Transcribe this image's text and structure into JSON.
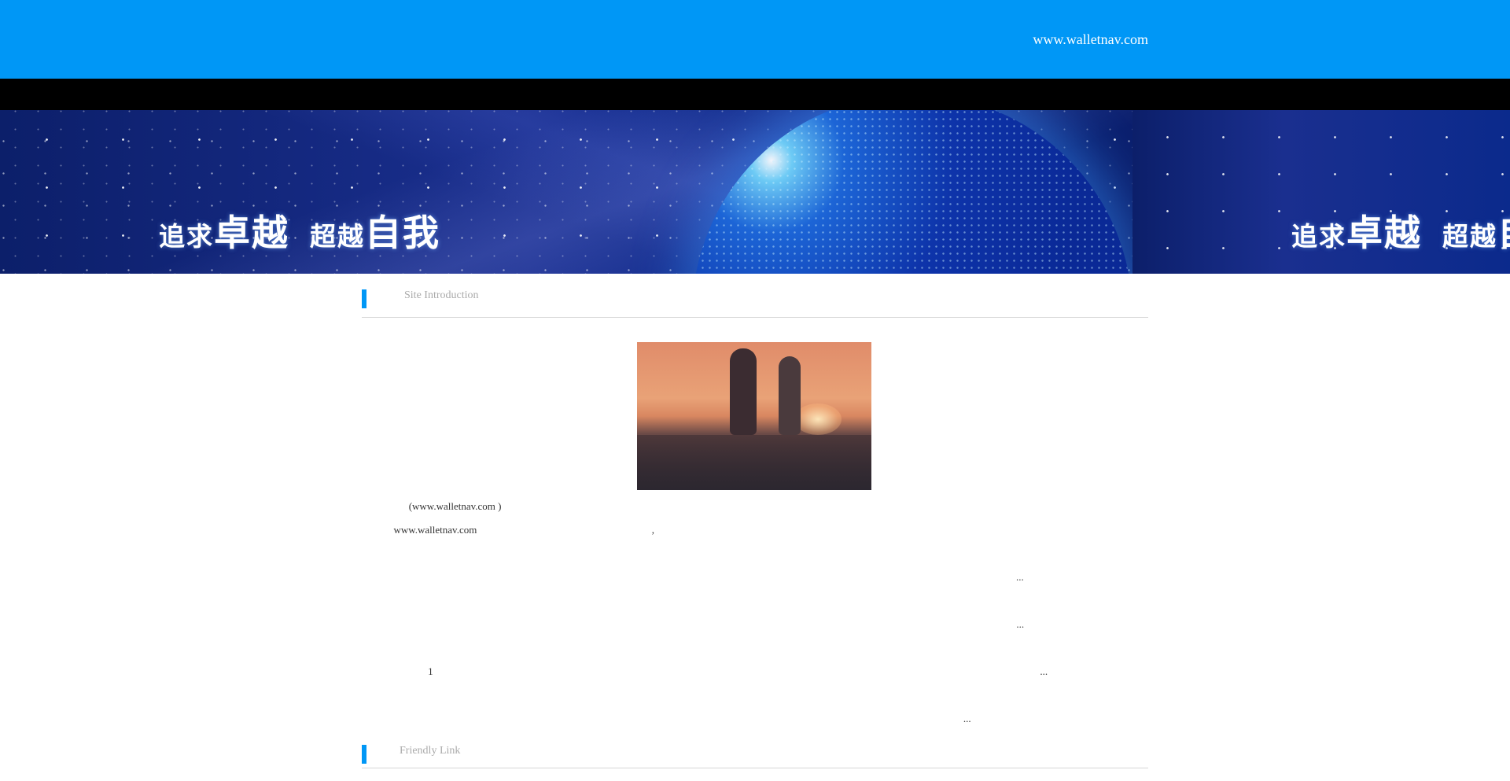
{
  "header": {
    "site_name": "\u0000\u0000\u0000\u0000\u0000",
    "site_url": "www.walletnav.com"
  },
  "nav": {
    "items": [
      {
        "label": "\u0000\u0000\u0000\u0000"
      },
      {
        "label": "\u0000\u0000\u0000"
      },
      {
        "label": "\u0000\u0000\u0000"
      },
      {
        "label": "\u0000\u0000\u0000"
      },
      {
        "label": "\u0000\u0000\u0000"
      },
      {
        "label": "\u0000\u0000\u0000"
      },
      {
        "label": "\u0000\u0000\u0000"
      },
      {
        "label": "\u0000\u0000\u0000"
      }
    ]
  },
  "banner": {
    "slogan_parts": [
      "追求",
      "卓越",
      "超越",
      "自我"
    ]
  },
  "intro_section": {
    "title_cn": "\u0000\u0000\u0000\u0000",
    "title_en": "Site Introduction"
  },
  "intro": {
    "paragraphs": [
      "\u0000\u0000\u0000\u0000 (www.walletnav.com )",
      "\u0000\u0000\u0000\u0000www.walletnav.com\u0000\u0000\u0000\u0000\u0000\u0000\u0000\u0000\u0000\u0000\u0000\u0000\u0000\u0000\u0000\u0000\u0000\u0000\u0000\u0000\u0000\u0000,\u0000\u0000\u0000\u0000\u0000\u0000\u0000\u0000\u0000\u0000\u0000\u0000\u0000\u0000\u0000\u0000\u0000\u0000\u0000\u0000\u0000\u0000\u0000\u0000\u0000\u0000\u0000\u0000\u0000\u0000\u0000\u0000\u0000\u0000\u0000",
      "\u0000\u0000\u0000",
      "\u0000\u0000\u0000\u0000\u0000\u0000\u0000\u0000\u0000\u0000 \u0000\u0000\u0000\u0000\u0000\u0000\u0000\u0000\u0000\u0000\u0000\u0000\u0000\u0000\u0000\u0000\u0000\u0000\u0000\u0000\u0000\u0000\u0000\u0000\u0000\u0000\u0000\u0000\u0000\u0000\u0000\u0000\u0000\u0000\u0000\u0000 \u0000\u0000\u0000 \u0000\u0000\u0000\u0000\u0000\u0000\u0000\u0000\u0000\u0000\u0000\u0000\u0000\u0000\u0000\u0000\u0000\u0000\u0000\u0000\u0000\u0000\u0000\u0000\u0000\u0000\u0000\u0000 \u0000\u0000\u0000\u0000...",
      "\u0000\u0000\u0000",
      "\u0000\u0000\u0000\u0000\u0000\u0000\u0000\u0000\u0000\u0000\u0000\u0000\u0000\u0000\u0000\u0000\u0000\u0000\u0000\u0000\u0000\u0000\u0000\u0000\u0000\u0000\u0000\u0000\u0000\u0000\u0000\u0000\u0000\u0000\u0000\u0000 \u0000\u0000\u0000\u0000\u0000\u0000\u0000\u0000\u0000\u0000\u0000\u0000\u0000\u0000\u0000\u0000\u0000\u0000\u0000\u0000\u0000\u0000\u0000\u0000\u0000\u0000\u0000\u0000\u0000\u0000\u0000\u0000\u0000\u0000\u0000\u0000\u0000\u0000\u0000\u0000\u0000\u0000\u0000\u0000\u0000\u0000...",
      "\u0000\u0000\u0000",
      "\u0000\u0000\u0000\u0000\u0000\u0000\u0000\u0000 1\u0000\u0000\u0000\u0000\u0000 \u0000\u0000\u0000\u0000\u0000\u0000\u0000\u0000\u0000\u0000\u0000\u0000\u0000\u0000\u0000\u0000\u0000\u0000\u0000\u0000\u0000\u0000\u0000\u0000\u0000\u0000\u0000\u0000\u0000\u0000\u0000\u0000\u0000\u0000\u0000\u0000\u0000\u0000\u0000\u0000\u0000\u0000\u0000\u0000\u0000\u0000\u0000\u0000\u0000\u0000\u0000\u0000\u0000\u0000\u0000\u0000\u0000\u0000\u0000\u0000\u0000\u0000\u0000\u0000\u0000\u0000\u0000\u0000\u0000\u0000\u0000...",
      "\u0000\u0000\u0000",
      "\u0000\u0000\u0000\u0000\u0000\u0000\u0000\u0000\u0000\u0000\u0000\u0000\u0000\u0000\u0000\u0000\u0000\u0000\u0000\u0000\u0000\u0000\u0000\u0000\u0000\u0000\u0000\u0000\u0000\u0000\u0000\u0000\u0000\u0000\u0000\u0000\u0000\u0000\u0000\u0000 \u0000\u0000\u0000\u0000\u0000\u0000\u0000\u0000\u0000\u0000\u0000\u0000\u0000\u0000\u0000\u0000 \u0000\u0000\u0000\u0000\u0000\u0000\u0000\u0000\u0000\u0000\u0000\u0000\u0000\u0000\u0000\u0000\u0000\u0000\u0000..."
    ]
  },
  "friend_section": {
    "title_cn": "\u0000\u0000\u0000",
    "title_en": "Friendly Link"
  },
  "colors": {
    "header_bg": "#0097f6",
    "nav_bg": "#000000",
    "accent_bar": "#0097f6"
  }
}
